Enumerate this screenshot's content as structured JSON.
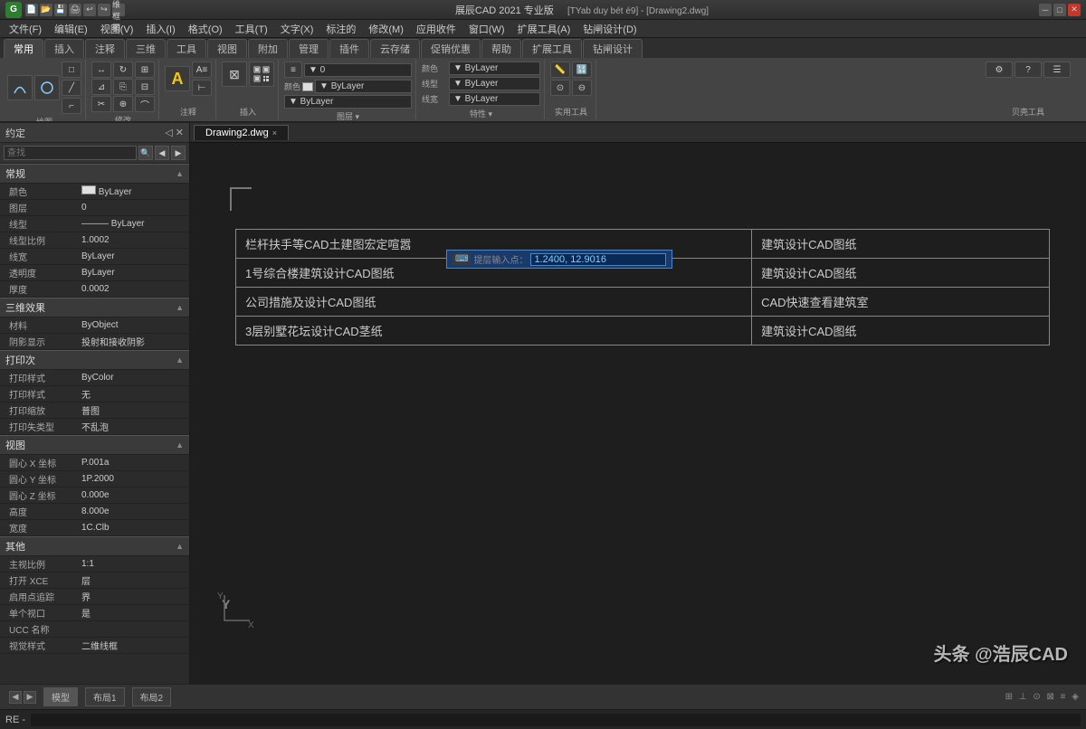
{
  "titlebar": {
    "logo": "G",
    "title": "展辰CAD 2021 专业版",
    "subtitle": "[TYab duy bét é9] - [Drawing2.dwg]",
    "close": "✕",
    "minimize": "─",
    "maximize": "□"
  },
  "menubar": {
    "items": [
      "文件(F)",
      "编辑(E)",
      "视图(V)",
      "插入(I)",
      "格式(O)",
      "工具(T)",
      "文字(X)",
      "标注的",
      "修改(M)",
      "应用收件",
      "窗口(W)",
      "扩展工具(A)",
      "钻闸设计(D)"
    ]
  },
  "ribbontabs": {
    "tabs": [
      "常用",
      "插入",
      "注释",
      "三维",
      "工具",
      "视图",
      "附加",
      "管理",
      "插件",
      "云存储",
      "促销优惠",
      "帮助",
      "扩展工具",
      "钻闸设计"
    ],
    "active": "常用"
  },
  "leftpanel": {
    "header": "约定",
    "search_placeholder": "查找",
    "sections": [
      {
        "label": "常规",
        "props": [
          {
            "label": "颜色",
            "value": "ByLayer",
            "hasColor": true
          },
          {
            "label": "图层",
            "value": "0"
          },
          {
            "label": "线型",
            "value": "——— ByLayer"
          },
          {
            "label": "线型比例",
            "value": "1.0002"
          },
          {
            "label": "线宽",
            "value": "ByLayer"
          },
          {
            "label": "透明度",
            "value": "ByLayer"
          },
          {
            "label": "厚度",
            "value": "0.0002"
          }
        ]
      },
      {
        "label": "三维效果",
        "props": [
          {
            "label": "材料",
            "value": "ByObject"
          },
          {
            "label": "阴影显示",
            "value": "投射和接收阴影"
          }
        ]
      },
      {
        "label": "打印次",
        "props": [
          {
            "label": "打印样式",
            "value": "ByColor"
          },
          {
            "label": "打印样式",
            "value": "无"
          },
          {
            "label": "打印缩放",
            "value": "普图"
          },
          {
            "label": "打印失类型",
            "value": "不乱泡"
          }
        ]
      },
      {
        "label": "视图",
        "props": [
          {
            "label": "圆心 X 坐标",
            "value": "P.001a"
          },
          {
            "label": "圆心 Y 坐标",
            "value": "1P.2000"
          },
          {
            "label": "圆心 Z 坐标",
            "value": "0.000e"
          },
          {
            "label": "高度",
            "value": "8.000e"
          },
          {
            "label": "宽度",
            "value": "1C.Clb"
          }
        ]
      },
      {
        "label": "其他",
        "props": [
          {
            "label": "主视比例",
            "value": "1:1"
          },
          {
            "label": "打开 XCE",
            "value": "层"
          },
          {
            "label": "启用点追踪",
            "value": "界"
          },
          {
            "label": "单个视口",
            "value": "是"
          },
          {
            "label": "UCC 名称",
            "value": ""
          },
          {
            "label": "视觉样式",
            "value": "二维线框"
          }
        ]
      }
    ]
  },
  "doctab": {
    "name": "Drawing2.dwg",
    "close": "×"
  },
  "table": {
    "rows": [
      {
        "col1": "栏杆扶手等CAD土建图宏定喧嚣",
        "col2": "建筑设计CAD图纸"
      },
      {
        "col1": "1号综合楼建筑设计CAD图纸",
        "col2": "建筑设计CAD图纸"
      },
      {
        "col1": "公司措施及设计CAD图纸",
        "col2": "CAD快速查看建筑室"
      },
      {
        "col1": "3层别墅花坛设计CAD茎纸",
        "col2": "建筑设计CAD图纸"
      }
    ]
  },
  "input_popup": {
    "label": "提层输入点：",
    "value": "1.2400, 12.9016"
  },
  "statusbar": {
    "tabs": [
      "模型",
      "布局1",
      "布局2"
    ],
    "active": "模型"
  },
  "commandbar": {
    "prompt": "RE -"
  },
  "watermark": "头条 @浩辰CAD",
  "bracket_symbol": "⌐",
  "y_axis": "Y"
}
